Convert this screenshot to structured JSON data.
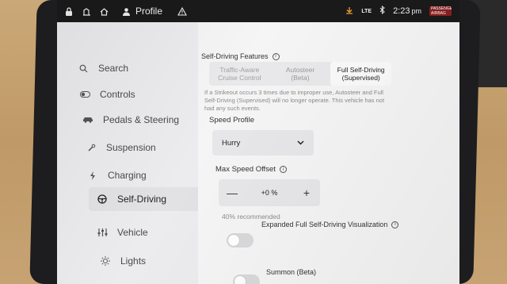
{
  "status_bar": {
    "profile_label": "Profile",
    "lte": "LTE",
    "time": "2:23",
    "ampm": "pm",
    "badge_text": "PASSENGER AIRBAG ON"
  },
  "sidebar": {
    "items": [
      {
        "label": "Search",
        "icon": "search-icon"
      },
      {
        "label": "Controls",
        "icon": "toggle-icon"
      },
      {
        "label": "Pedals & Steering",
        "icon": "car-icon"
      },
      {
        "label": "Suspension",
        "icon": "wrench-icon"
      },
      {
        "label": "Charging",
        "icon": "bolt-icon"
      },
      {
        "label": "Self-Driving",
        "icon": "steering-wheel-icon",
        "active": true
      },
      {
        "label": "Vehicle",
        "icon": "sliders-icon"
      },
      {
        "label": "Lights",
        "icon": "sun-icon"
      }
    ]
  },
  "main": {
    "section_title": "Self-Driving Features",
    "segments": [
      {
        "label_line1": "Traffic-Aware",
        "label_line2": "Cruise Control"
      },
      {
        "label_line1": "Autosteer",
        "label_line2": "(Beta)"
      },
      {
        "label_line1": "Full Self-Driving",
        "label_line2": "(Supervised)",
        "active": true
      }
    ],
    "warning_text": "If a Strikeout occurs 3 times due to improper use, Autosteer and Full Self-Driving (Supervised) will no longer operate. This vehicle has not had any such events.",
    "speed_profile_label": "Speed Profile",
    "speed_profile_value": "Hurry",
    "max_speed_offset_label": "Max Speed Offset",
    "offset_minus": "—",
    "offset_value": "+0 %",
    "offset_plus": "+",
    "offset_hint": "40% recommended",
    "toggle_visualization_label": "Expanded Full Self-Driving Visualization",
    "toggle_summon_label": "Summon (Beta)"
  },
  "colors": {
    "screen_bg": "#f1f1f3",
    "status_bar_bg": "#1a1a1a",
    "active_nav_bg": "#e2e2e5"
  }
}
